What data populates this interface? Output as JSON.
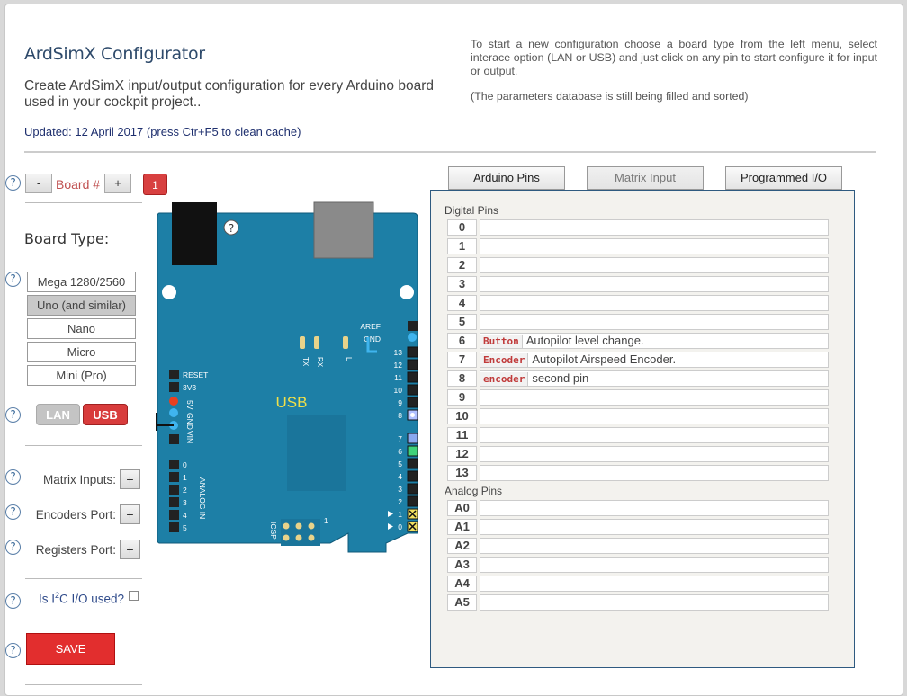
{
  "header": {
    "title": "ArdSimX Configurator",
    "description": "Create ArdSimX input/output configuration for every Arduino board used in your cockpit project..",
    "updated": "Updated: 12 April 2017 (press Ctr+F5 to clean cache)",
    "help_text": "To start a new configuration choose a board type from the left menu, select interace option (LAN or USB) and just click on any pin to start configure it for input or output.",
    "help_note": "(The parameters database is still being filled and sorted)"
  },
  "sidebar": {
    "help_glyph": "?",
    "board_minus": "-",
    "board_label": "Board #",
    "board_plus": "+",
    "board_number": "1",
    "board_type_label": "Board Type:",
    "board_types": [
      {
        "label": "Mega 1280/2560",
        "selected": false
      },
      {
        "label": "Uno (and similar)",
        "selected": true
      },
      {
        "label": "Nano",
        "selected": false
      },
      {
        "label": "Micro",
        "selected": false
      },
      {
        "label": "Mini (Pro)",
        "selected": false
      }
    ],
    "interface_lan": "LAN",
    "interface_usb": "USB",
    "selected_interface": "USB",
    "matrix_inputs_label": "Matrix Inputs:",
    "encoders_port_label": "Encoders Port:",
    "registers_port_label": "Registers Port:",
    "plus": "+",
    "i2c_label_pre": "Is I",
    "i2c_label_sup": "2",
    "i2c_label_post": "C I/O used?",
    "i2c_checked": false,
    "save_label": "SAVE"
  },
  "board": {
    "usb_label": "USB",
    "help_glyph": "?",
    "aref": "AREF",
    "gnd": "GND",
    "reset": "RESET",
    "v33": "3V3",
    "v5": "5V",
    "gnd2": "GND",
    "vin": "VIN",
    "analog_in": "ANALOG IN",
    "tx": "TX",
    "rx": "RX",
    "l": "L",
    "icsp": "ICSP",
    "icsp_num": "1",
    "right_pins": [
      "13",
      "12",
      "11",
      "10",
      "9",
      "8",
      "7",
      "6",
      "5",
      "4",
      "3",
      "2",
      "1",
      "0"
    ],
    "analog_pins": [
      "0",
      "1",
      "2",
      "3",
      "4",
      "5"
    ]
  },
  "tabs": [
    {
      "label": "Arduino Pins",
      "enabled": true
    },
    {
      "label": "Matrix Input",
      "enabled": false
    },
    {
      "label": "Programmed I/O",
      "enabled": true
    }
  ],
  "pins": {
    "digital_label": "Digital Pins",
    "analog_label": "Analog Pins",
    "digital": [
      {
        "pin": "0",
        "type": "",
        "desc": ""
      },
      {
        "pin": "1",
        "type": "",
        "desc": ""
      },
      {
        "pin": "2",
        "type": "",
        "desc": ""
      },
      {
        "pin": "3",
        "type": "",
        "desc": ""
      },
      {
        "pin": "4",
        "type": "",
        "desc": ""
      },
      {
        "pin": "5",
        "type": "",
        "desc": ""
      },
      {
        "pin": "6",
        "type": "Button",
        "desc": "Autopilot level change."
      },
      {
        "pin": "7",
        "type": "Encoder",
        "desc": "Autopilot Airspeed Encoder."
      },
      {
        "pin": "8",
        "type": "encoder",
        "desc": "second pin"
      },
      {
        "pin": "9",
        "type": "",
        "desc": ""
      },
      {
        "pin": "10",
        "type": "",
        "desc": ""
      },
      {
        "pin": "11",
        "type": "",
        "desc": ""
      },
      {
        "pin": "12",
        "type": "",
        "desc": ""
      },
      {
        "pin": "13",
        "type": "",
        "desc": ""
      }
    ],
    "analog": [
      {
        "pin": "A0",
        "type": "",
        "desc": ""
      },
      {
        "pin": "A1",
        "type": "",
        "desc": ""
      },
      {
        "pin": "A2",
        "type": "",
        "desc": ""
      },
      {
        "pin": "A3",
        "type": "",
        "desc": ""
      },
      {
        "pin": "A4",
        "type": "",
        "desc": ""
      },
      {
        "pin": "A5",
        "type": "",
        "desc": ""
      }
    ]
  },
  "colors": {
    "accent_red": "#d83c3c",
    "board_teal": "#1d7fa6",
    "panel_border": "#2e5a80"
  }
}
